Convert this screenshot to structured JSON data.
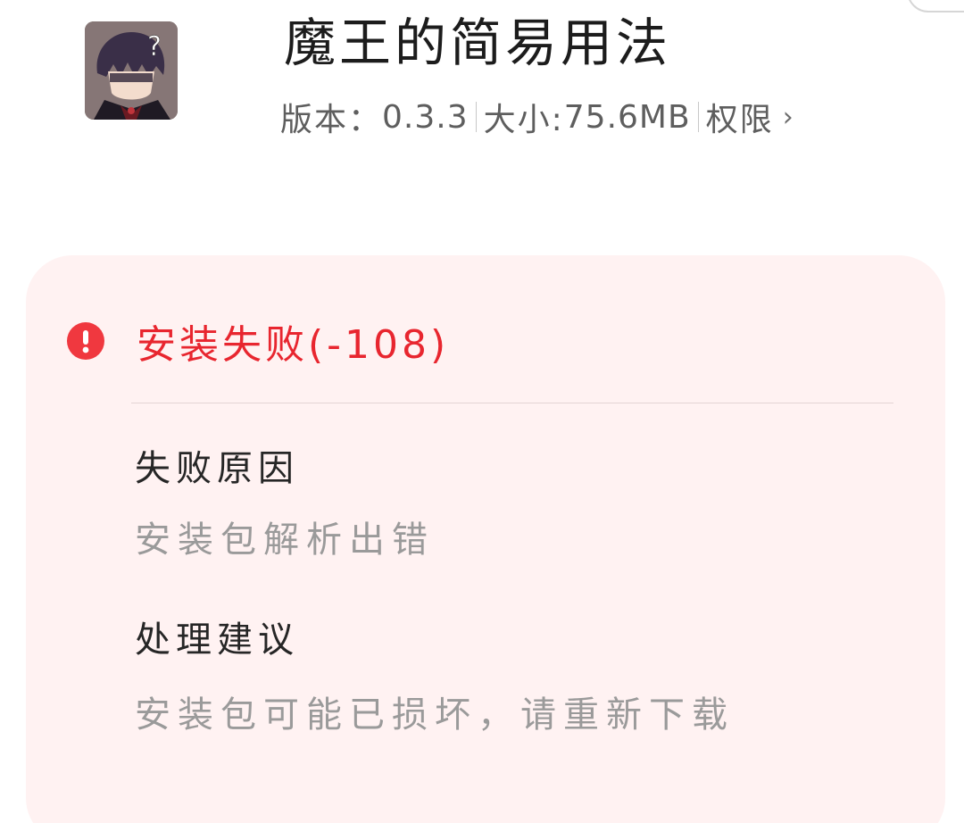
{
  "app": {
    "name": "魔王的简易用法",
    "version_label": "版本：",
    "version": "0.3.3",
    "size_label": "大小:",
    "size": "75.6MB",
    "permissions_label": "权限",
    "permissions_chevron": "›",
    "icon": "app-icon-character"
  },
  "install_result": {
    "status": "安装失败(-108)",
    "status_icon": "alert-icon",
    "status_color": "#e8262f",
    "reason_title": "失败原因",
    "reason_text": "安装包解析出错",
    "suggestion_title": "处理建议",
    "suggestion_text": "安装包可能已损坏，请重新下载"
  },
  "colors": {
    "card_background": "#fff2f2",
    "alert_red": "#f0383f",
    "primary_text": "#262626",
    "secondary_text": "#9a9a9a"
  }
}
